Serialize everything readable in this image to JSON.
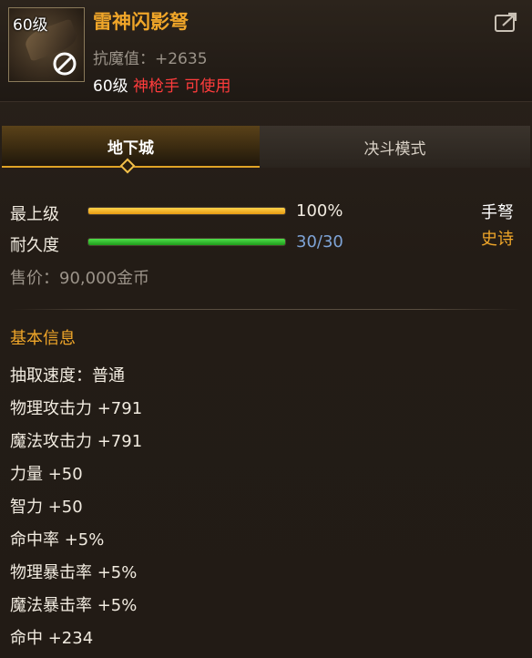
{
  "header": {
    "level_badge": "60级",
    "item_name": "雷神闪影弩",
    "stat_line": "抗魔值：+2635",
    "req_level": "60级 ",
    "req_class": "神枪手 可使用"
  },
  "tabs": [
    {
      "label": "地下城",
      "active": true
    },
    {
      "label": "决斗模式",
      "active": false
    }
  ],
  "bars": {
    "max_level": {
      "label": "最上级",
      "value": "100%",
      "fill": 1.0
    },
    "durability": {
      "label": "耐久度",
      "value": "30/30",
      "fill": 1.0
    }
  },
  "item_type": "手弩",
  "rarity": "史诗",
  "price": "售价：90,000金币",
  "basic_info": {
    "title": "基本信息",
    "attributes": [
      "抽取速度：普通",
      "物理攻击力 +791",
      "魔法攻击力 +791",
      "力量 +50",
      "智力 +50",
      "命中率 +5%",
      "物理暴击率 +5%",
      "魔法暴击率 +5%",
      "命中 +234"
    ]
  },
  "colors": {
    "accent_orange": "#f0a629",
    "red": "#ff3c3c",
    "blue": "#7ea3d6",
    "grey": "#9b9389"
  },
  "icons": {
    "forbid": "forbid-icon",
    "share": "share-icon"
  }
}
